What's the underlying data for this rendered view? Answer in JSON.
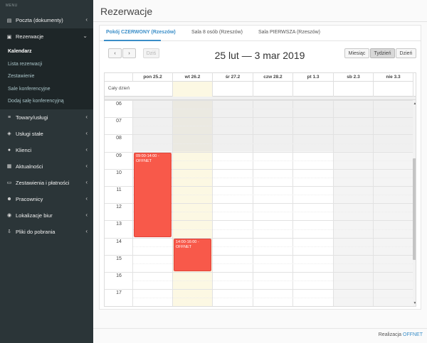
{
  "sidebar": {
    "header": "MENU",
    "items": [
      {
        "label": "Poczta (dokumenty)",
        "icon": "envelope-icon",
        "glyph": "▤"
      },
      {
        "label": "Rezerwacje",
        "icon": "briefcase-icon",
        "glyph": "▣"
      },
      {
        "label": "Towary/usługi",
        "icon": "list-icon",
        "glyph": "≡"
      },
      {
        "label": "Usługi stałe",
        "icon": "cube-icon",
        "glyph": "◈"
      },
      {
        "label": "Klienci",
        "icon": "users-icon",
        "glyph": "●"
      },
      {
        "label": "Aktualności",
        "icon": "newspaper-icon",
        "glyph": "▦"
      },
      {
        "label": "Zestawienia i płatności",
        "icon": "money-icon",
        "glyph": "▭"
      },
      {
        "label": "Pracownicy",
        "icon": "user-icon",
        "glyph": "☻"
      },
      {
        "label": "Lokalizacje biur",
        "icon": "map-marker-icon",
        "glyph": "◉"
      },
      {
        "label": "Pliki do pobrania",
        "icon": "download-icon",
        "glyph": "⇩"
      }
    ],
    "submenu": [
      "Kalendarz",
      "Lista rezerwacji",
      "Zestawienie",
      "Sale konferencyjne",
      "Dodaj salę konferencyjną"
    ]
  },
  "main": {
    "title": "Rezerwacje",
    "tabs": [
      "Pokój CZERWONY (Rzeszów)",
      "Sala 8 osób (Rzeszów)",
      "Sala PIERWSZA (Rzeszów)"
    ],
    "toolbar": {
      "prev": "‹",
      "next": "›",
      "today": "Dziś",
      "month": "Miesiąc",
      "week": "Tydzień",
      "day": "Dzień"
    },
    "range": "25 lut — 3 mar 2019"
  },
  "calendar": {
    "days": [
      "pon 25.2",
      "wt 26.2",
      "śr 27.2",
      "czw 28.2",
      "pt 1.3",
      "sb 2.3",
      "nie 3.3"
    ],
    "allday": "Cały dzień",
    "hours": [
      "06",
      "07",
      "08",
      "09",
      "10",
      "11",
      "12",
      "13",
      "14",
      "15",
      "16",
      "17"
    ],
    "events": [
      {
        "day": 0,
        "start": 9,
        "end": 14,
        "time": "09:00-14:00 -",
        "title": "OFFNET"
      },
      {
        "day": 1,
        "start": 14,
        "end": 16,
        "time": "14:00-16:00 -",
        "title": "OFFNET"
      }
    ],
    "scroll_up": "▲",
    "scroll_down": "▼"
  },
  "footer": {
    "text": "Realizacja",
    "link": "OFFNET"
  },
  "colors": {
    "event": "#f8594a",
    "today": "#fcf8e3",
    "accent": "#3a8ec8",
    "sidebar": "#2b3538"
  }
}
